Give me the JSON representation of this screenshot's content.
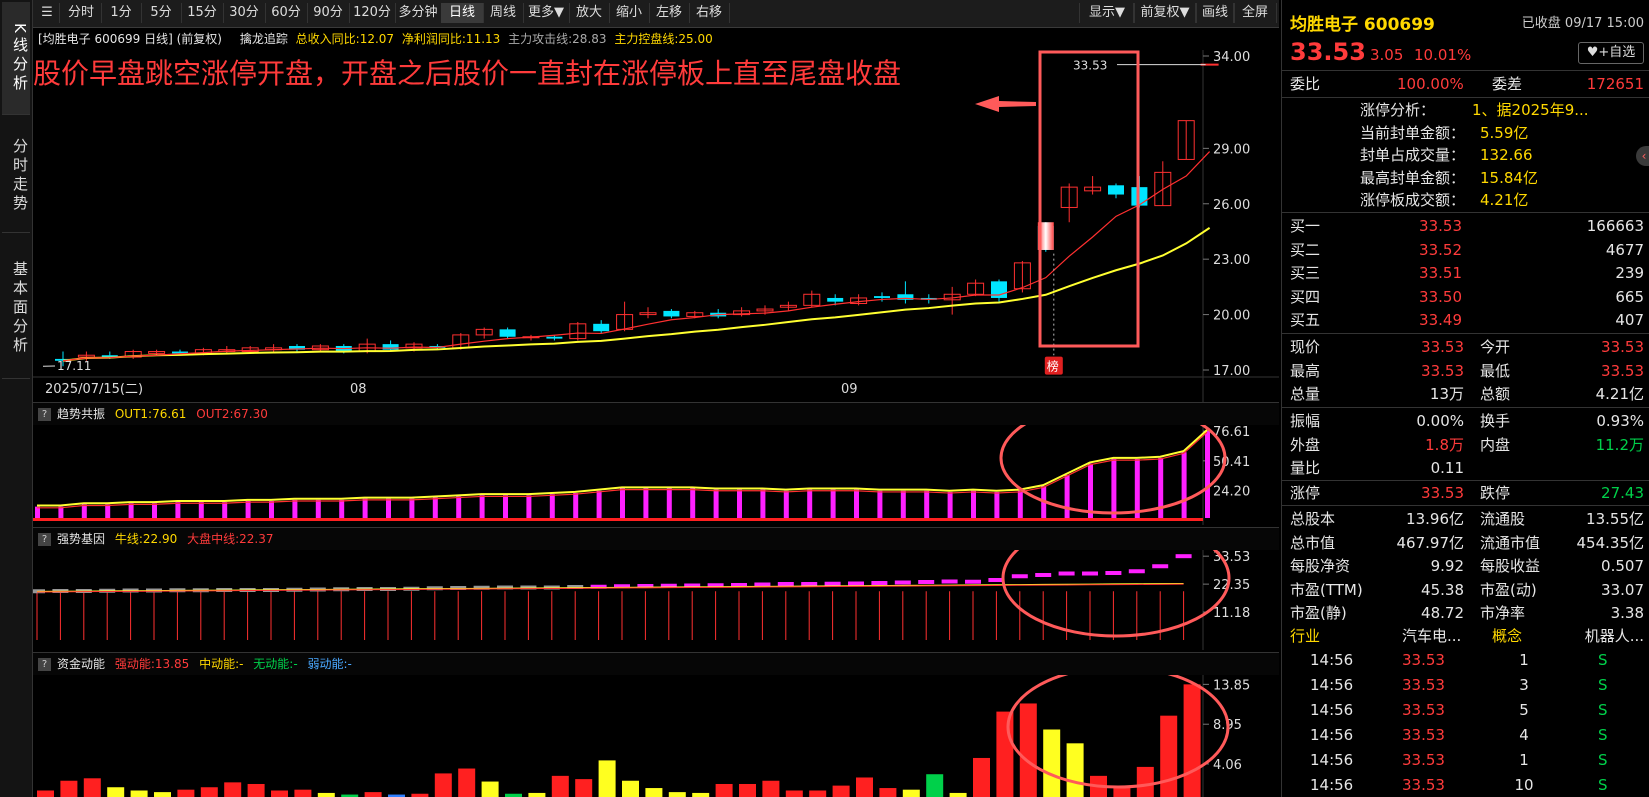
{
  "sidebar": {
    "tabs": [
      {
        "label": "K线分析",
        "active": true
      },
      {
        "label": "分时走势",
        "active": false
      },
      {
        "label": "基本面分析",
        "active": false
      }
    ]
  },
  "toolbar": {
    "left_items": [
      "分时",
      "1分",
      "5分",
      "15分",
      "30分",
      "60分",
      "90分",
      "120分",
      "多分钟",
      "日线",
      "周线",
      "更多▼",
      "放大",
      "缩小",
      "左移",
      "右移"
    ],
    "active_item": "日线",
    "right_items": [
      "显示▼",
      "前复权▼",
      "画线",
      "全屏"
    ]
  },
  "info_bar": {
    "stock": "[均胜电子 600699 日线] (前复权)",
    "indicator_name": "擒龙追踪",
    "revenue_yoy": "总收入同比:12.07",
    "profit_yoy": "净利润同比:11.13",
    "attack_line": "主力攻击线:28.83",
    "control_line": "主力控盘线:25.00"
  },
  "main_chart": {
    "annotation": "股价早盘跳空涨停开盘，开盘之后股价一直封在涨停板上直至尾盘收盘",
    "high_label": "33.53",
    "low_label": "17.11",
    "bang_label": "榜",
    "x_labels": [
      "2025/07/15(二)",
      "08",
      "09"
    ],
    "y_ticks": [
      "34.00",
      "29.00",
      "26.00",
      "23.00",
      "20.00",
      "17.00"
    ]
  },
  "panel1": {
    "title": "趋势共振",
    "out1": "OUT1:76.61",
    "out2": "OUT2:67.30",
    "y_ticks": [
      "76.61",
      "50.41",
      "24.20"
    ]
  },
  "panel2": {
    "title": "强势基因",
    "bull": "牛线:22.90",
    "market": "大盘中线:22.37",
    "y_ticks": [
      "33.53",
      "22.35",
      "11.18"
    ]
  },
  "panel3": {
    "title": "资金动能",
    "strong": "强动能:13.85",
    "mid": "中动能:-",
    "none": "无动能:-",
    "weak": "弱动能:-",
    "y_ticks": [
      "13.85",
      "8.95",
      "4.06"
    ]
  },
  "quote": {
    "name_code": "均胜电子 600699",
    "status": "已收盘 09/17 15:00",
    "price": "33.53",
    "change": "3.05",
    "change_pct": "10.01%",
    "watch_btn": "+自选",
    "weibi_label": "委比",
    "weibi": "100.00%",
    "weicha_label": "委差",
    "weicha": "172651",
    "limit_info": [
      {
        "label": "涨停分析：",
        "value": "1、据2025年9..."
      },
      {
        "label": "当前封单金额：",
        "value": "5.59亿"
      },
      {
        "label": "封单占成交量：",
        "value": "132.66"
      },
      {
        "label": "最高封单金额：",
        "value": "15.84亿"
      },
      {
        "label": "涨停板成交额：",
        "value": "4.21亿"
      }
    ],
    "bids": [
      {
        "label": "买一",
        "price": "33.53",
        "vol": "166663"
      },
      {
        "label": "买二",
        "price": "33.52",
        "vol": "4677"
      },
      {
        "label": "买三",
        "price": "33.51",
        "vol": "239"
      },
      {
        "label": "买四",
        "price": "33.50",
        "vol": "665"
      },
      {
        "label": "买五",
        "price": "33.49",
        "vol": "407"
      }
    ],
    "stats1": [
      {
        "l1": "现价",
        "v1": "33.53",
        "c1": "red",
        "l2": "今开",
        "v2": "33.53",
        "c2": "red"
      },
      {
        "l1": "最高",
        "v1": "33.53",
        "c1": "red",
        "l2": "最低",
        "v2": "33.53",
        "c2": "red"
      },
      {
        "l1": "总量",
        "v1": "13万",
        "c1": "white",
        "l2": "总额",
        "v2": "4.21亿",
        "c2": "white"
      }
    ],
    "stats2": [
      {
        "l1": "振幅",
        "v1": "0.00%",
        "c1": "white",
        "l2": "换手",
        "v2": "0.93%",
        "c2": "white"
      },
      {
        "l1": "外盘",
        "v1": "1.8万",
        "c1": "red",
        "l2": "内盘",
        "v2": "11.2万",
        "c2": "green"
      },
      {
        "l1": "量比",
        "v1": "0.11",
        "c1": "white",
        "l2": "",
        "v2": "",
        "c2": "white"
      }
    ],
    "stats3": [
      {
        "l1": "涨停",
        "v1": "33.53",
        "c1": "red",
        "l2": "跌停",
        "v2": "27.43",
        "c2": "green"
      }
    ],
    "stats4": [
      {
        "l1": "总股本",
        "v1": "13.96亿",
        "l2": "流通股",
        "v2": "13.55亿"
      },
      {
        "l1": "总市值",
        "v1": "467.97亿",
        "l2": "流通市值",
        "v2": "454.35亿"
      },
      {
        "l1": "每股净资",
        "v1": "9.92",
        "l2": "每股收益",
        "v2": "0.507"
      },
      {
        "l1": "市盈(TTM)",
        "v1": "45.38",
        "l2": "市盈(动)",
        "v2": "33.07"
      },
      {
        "l1": "市盈(静)",
        "v1": "48.72",
        "l2": "市净率",
        "v2": "3.38"
      }
    ],
    "industry_label": "行业",
    "industry": "汽车电...",
    "concept_label": "概念",
    "concept": "机器人...",
    "ticks": [
      {
        "time": "14:56",
        "price": "33.53",
        "vol": "1",
        "side": "S"
      },
      {
        "time": "14:56",
        "price": "33.53",
        "vol": "3",
        "side": "S"
      },
      {
        "time": "14:56",
        "price": "33.53",
        "vol": "5",
        "side": "S"
      },
      {
        "time": "14:56",
        "price": "33.53",
        "vol": "4",
        "side": "S"
      },
      {
        "time": "14:56",
        "price": "33.53",
        "vol": "1",
        "side": "S"
      },
      {
        "time": "14:56",
        "price": "33.53",
        "vol": "10",
        "side": "S"
      }
    ]
  },
  "chart_data": {
    "type": "candlestick",
    "candles": [
      [
        17.6,
        17.5,
        18.0,
        17.2
      ],
      [
        17.7,
        17.8,
        18.0,
        17.5
      ],
      [
        17.8,
        17.7,
        18.0,
        17.6
      ],
      [
        17.7,
        18.0,
        18.1,
        17.6
      ],
      [
        17.9,
        18.0,
        18.1,
        17.8
      ],
      [
        18.0,
        17.9,
        18.1,
        17.8
      ],
      [
        17.9,
        18.1,
        18.2,
        17.8
      ],
      [
        18.0,
        18.1,
        18.3,
        17.9
      ],
      [
        18.0,
        18.2,
        18.3,
        17.9
      ],
      [
        18.1,
        18.2,
        18.4,
        18.0
      ],
      [
        18.3,
        18.1,
        18.4,
        18.0
      ],
      [
        18.1,
        18.3,
        18.4,
        18.0
      ],
      [
        18.3,
        18.0,
        18.4,
        17.9
      ],
      [
        18.0,
        18.4,
        18.7,
        17.9
      ],
      [
        18.4,
        18.1,
        18.6,
        18.0
      ],
      [
        18.2,
        18.4,
        18.5,
        18.0
      ],
      [
        18.3,
        18.2,
        18.4,
        18.1
      ],
      [
        18.2,
        18.9,
        19.0,
        18.1
      ],
      [
        18.9,
        19.2,
        19.3,
        18.7
      ],
      [
        19.2,
        18.8,
        19.3,
        18.7
      ],
      [
        18.8,
        18.8,
        18.9,
        18.6
      ],
      [
        18.8,
        18.7,
        18.9,
        18.6
      ],
      [
        18.7,
        19.5,
        19.6,
        18.6
      ],
      [
        19.5,
        19.1,
        19.7,
        19.0
      ],
      [
        19.2,
        20.0,
        20.7,
        19.1
      ],
      [
        20.0,
        20.1,
        20.4,
        19.8
      ],
      [
        20.2,
        19.9,
        20.3,
        19.8
      ],
      [
        19.9,
        20.1,
        20.2,
        19.8
      ],
      [
        20.1,
        19.9,
        20.3,
        19.8
      ],
      [
        20.0,
        20.2,
        20.4,
        19.9
      ],
      [
        20.2,
        20.3,
        20.5,
        20.0
      ],
      [
        20.4,
        20.5,
        20.7,
        20.2
      ],
      [
        20.5,
        21.1,
        21.3,
        20.4
      ],
      [
        20.9,
        20.7,
        21.1,
        20.5
      ],
      [
        20.6,
        20.9,
        21.1,
        20.5
      ],
      [
        21.0,
        20.9,
        21.2,
        20.7
      ],
      [
        21.1,
        20.8,
        21.8,
        20.6
      ],
      [
        20.9,
        20.8,
        21.1,
        20.6
      ],
      [
        20.8,
        21.1,
        21.5,
        20.0
      ],
      [
        21.1,
        21.7,
        21.9,
        21.0
      ],
      [
        21.8,
        20.9,
        21.9,
        20.7
      ],
      [
        21.4,
        22.8,
        22.9,
        21.2
      ],
      [
        24.8,
        23.5,
        25.0,
        23.4
      ],
      [
        25.8,
        26.9,
        27.1,
        25.0
      ],
      [
        26.7,
        26.9,
        27.5,
        26.5
      ],
      [
        27.0,
        26.5,
        27.1,
        26.3
      ],
      [
        26.9,
        25.9,
        27.5,
        25.8
      ],
      [
        25.9,
        27.7,
        28.3,
        25.9
      ],
      [
        28.4,
        30.5,
        30.5,
        28.4
      ],
      [
        33.53,
        33.53,
        33.53,
        33.53
      ]
    ],
    "ma_attack_last": 28.83,
    "ma_control_last": 25.0,
    "ylim": [
      17.0,
      34.0
    ],
    "panel1_bars": [
      10,
      10,
      12,
      12,
      13,
      13,
      14,
      14,
      14,
      15,
      15,
      16,
      16,
      16,
      17,
      17,
      17,
      18,
      19,
      20,
      20,
      20,
      21,
      22,
      24,
      26,
      26,
      26,
      26,
      25,
      25,
      25,
      24,
      25,
      25,
      25,
      24,
      24,
      24,
      23,
      24,
      23,
      24,
      28,
      38,
      48,
      52,
      52,
      53,
      58,
      76.61
    ],
    "panel1_ylim": [
      0,
      82
    ],
    "panel2_dashes": [
      19.5,
      19.6,
      19.6,
      19.7,
      19.8,
      19.8,
      19.9,
      19.9,
      20.0,
      20.0,
      20.0,
      20.1,
      20.2,
      20.3,
      20.4,
      20.4,
      20.5,
      20.7,
      20.8,
      20.9,
      21.0,
      21.0,
      21.0,
      21.2,
      21.3,
      21.5,
      21.6,
      21.7,
      21.8,
      21.9,
      22.0,
      22.2,
      22.4,
      22.4,
      22.5,
      22.6,
      22.8,
      23.0,
      23.2,
      23.4,
      23.3,
      24.0,
      25.5,
      26.0,
      26.6,
      26.6,
      26.8,
      27.5,
      29.5,
      33.53
    ],
    "panel2_ylim": [
      0,
      36
    ],
    "panel3_bars": [
      [
        0.8,
        "red"
      ],
      [
        2.0,
        "red"
      ],
      [
        2.3,
        "red"
      ],
      [
        1.2,
        "yellow"
      ],
      [
        0.8,
        "yellow"
      ],
      [
        0.6,
        "yellow"
      ],
      [
        0.9,
        "red"
      ],
      [
        1.2,
        "red"
      ],
      [
        1.8,
        "red"
      ],
      [
        1.6,
        "red"
      ],
      [
        0.8,
        "red"
      ],
      [
        0.9,
        "red"
      ],
      [
        0.5,
        "yellow"
      ],
      [
        0.3,
        "green"
      ],
      [
        0.6,
        "red"
      ],
      [
        0.3,
        "blue"
      ],
      [
        0.4,
        "red"
      ],
      [
        2.9,
        "red"
      ],
      [
        3.5,
        "red"
      ],
      [
        1.9,
        "yellow"
      ],
      [
        0.4,
        "green"
      ],
      [
        0.5,
        "yellow"
      ],
      [
        2.6,
        "red"
      ],
      [
        2.2,
        "red"
      ],
      [
        4.5,
        "yellow"
      ],
      [
        2.0,
        "yellow"
      ],
      [
        1.1,
        "yellow"
      ],
      [
        0.6,
        "yellow"
      ],
      [
        0.5,
        "yellow"
      ],
      [
        1.6,
        "red"
      ],
      [
        1.6,
        "red"
      ],
      [
        2.0,
        "red"
      ],
      [
        0.8,
        "red"
      ],
      [
        0.8,
        "red"
      ],
      [
        1.4,
        "red"
      ],
      [
        2.4,
        "red"
      ],
      [
        1.1,
        "red"
      ],
      [
        0.9,
        "yellow"
      ],
      [
        2.8,
        "green"
      ],
      [
        0.5,
        "yellow"
      ],
      [
        4.8,
        "red"
      ],
      [
        10.5,
        "red"
      ],
      [
        11.5,
        "red"
      ],
      [
        8.3,
        "yellow"
      ],
      [
        6.6,
        "yellow"
      ],
      [
        2.6,
        "red"
      ],
      [
        1.2,
        "red"
      ],
      [
        3.7,
        "red"
      ],
      [
        10.0,
        "red"
      ],
      [
        13.85,
        "red"
      ]
    ],
    "panel3_ylim": [
      0,
      15
    ]
  }
}
